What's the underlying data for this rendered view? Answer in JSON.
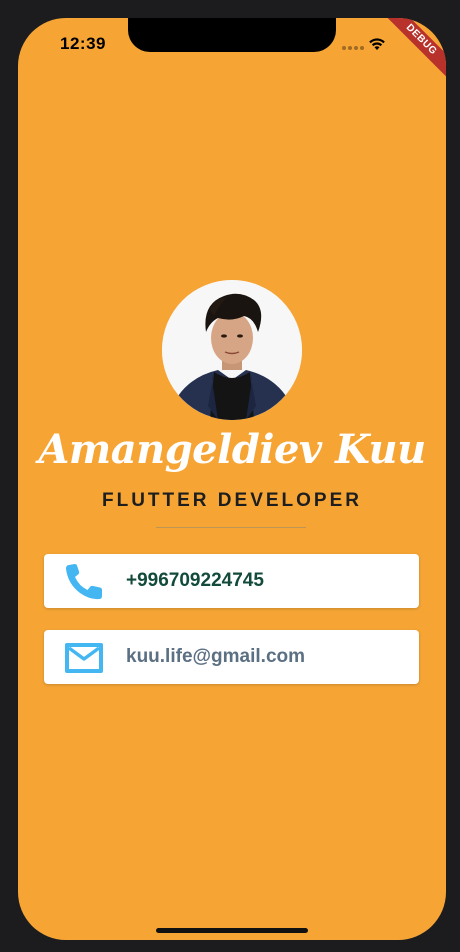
{
  "status_bar": {
    "time": "12:39",
    "debug_banner": "DEBUG"
  },
  "profile": {
    "name": "Amangeldiev Kuu",
    "title": "FLUTTER DEVELOPER"
  },
  "contacts": {
    "phone": {
      "value": "+996709224745",
      "icon": "phone-icon"
    },
    "email": {
      "value": "kuu.life@gmail.com",
      "icon": "mail-icon"
    }
  },
  "colors": {
    "background": "#f6a535",
    "card": "#ffffff",
    "icon_accent": "#44b6f2",
    "phone_text": "#124a3b",
    "email_text": "#5b7083"
  }
}
